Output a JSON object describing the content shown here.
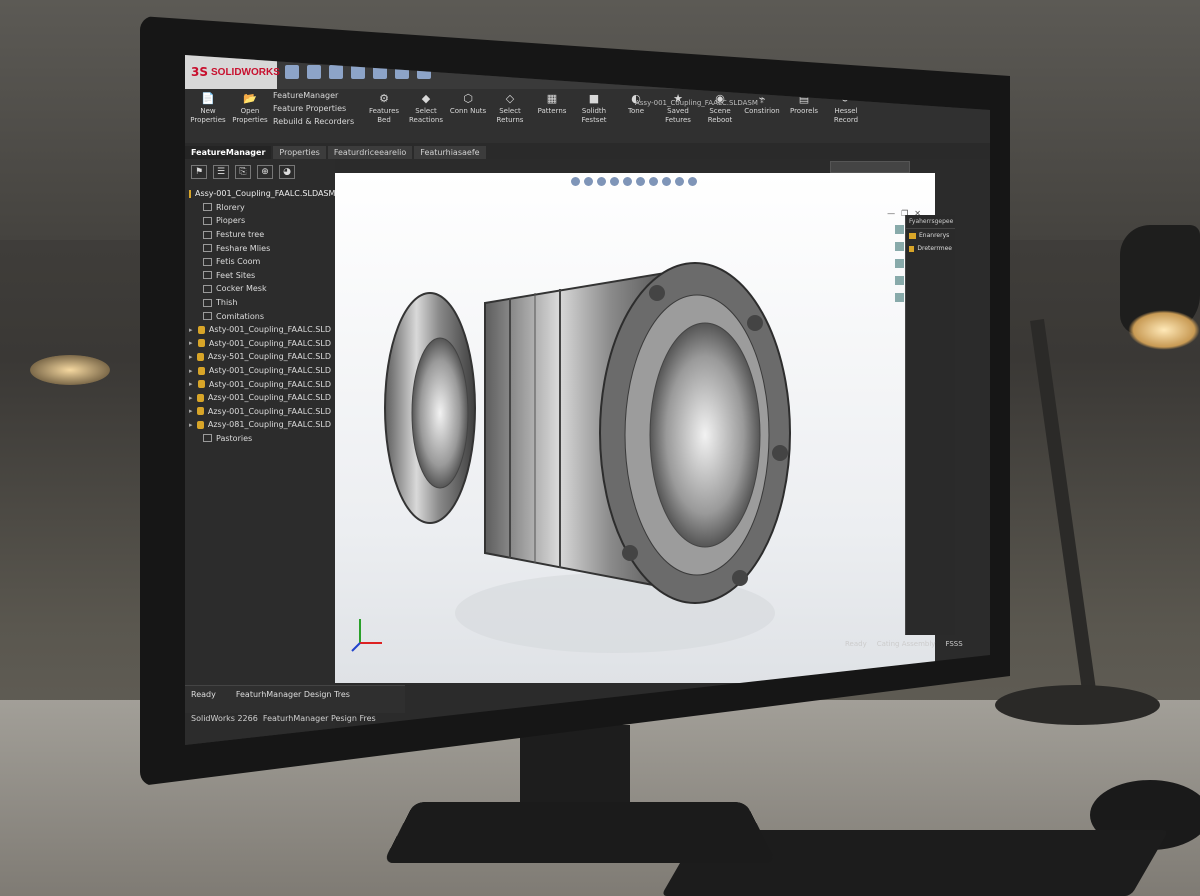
{
  "app": {
    "logo_text": "SOLIDWORKS",
    "document_title": "Assy-001_Coupling_FAALC.SLDASM *"
  },
  "ribbon": {
    "buttons": [
      {
        "label": "New Properties",
        "icon": "new-document-icon"
      },
      {
        "label": "Open Properties",
        "icon": "open-folder-icon"
      }
    ],
    "column": [
      "FeatureManager",
      "Feature Properties",
      "Rebuild & Recorders"
    ],
    "group": [
      {
        "label": "Features Bed",
        "icon": "features-icon"
      },
      {
        "label": "Select Reactions",
        "icon": "select-icon"
      },
      {
        "label": "Conn Nuts",
        "icon": "connect-icon"
      },
      {
        "label": "Select Returns",
        "icon": "select-returns-icon"
      },
      {
        "label": "Patterns",
        "icon": "pattern-icon"
      },
      {
        "label": "Solidth Festset",
        "icon": "solid-icon"
      },
      {
        "label": "Tone",
        "icon": "tone-icon"
      },
      {
        "label": "Saved Fetures",
        "icon": "saved-icon"
      },
      {
        "label": "Scene Reboot",
        "icon": "scene-icon"
      },
      {
        "label": "Constirion",
        "icon": "constraint-icon"
      },
      {
        "label": "Proorels",
        "icon": "process-icon"
      },
      {
        "label": "Hessel Record",
        "icon": "record-icon"
      }
    ]
  },
  "tabs": [
    "FeatureManager",
    "Properties",
    "Featurdriceearelio",
    "Featurhiasaefe"
  ],
  "tree": {
    "root": "Assy-001_Coupling_FAALC.SLDASM",
    "items": [
      "Rlorery",
      "Piopers",
      "Festure tree",
      "Feshare Mlies",
      "Fetis Coom",
      "Feet Sites",
      "Cocker Mesk",
      "Thish",
      "Comitations"
    ],
    "parts": [
      "Asty-001_Coupling_FAALC.SLD",
      "Asty-001_Coupling_FAALC.SLD",
      "Azsy-501_Coupling_FAALC.SLD",
      "Asty-001_Coupling_FAALC.SLD",
      "Asty-001_Coupling_FAALC.SLD",
      "Azsy-001_Coupling_FAALC.SLD",
      "Azsy-001_Coupling_FAALC.SLD",
      "Azsy-081_Coupling_FAALC.SLD"
    ],
    "last": "Pastories"
  },
  "status": {
    "left_ready": "Ready",
    "left_tree": "FeaturhManager Design Tres",
    "bottom_app": "SolidWorks 2266",
    "bottom_tree": "FeaturhManager Pesign Fres",
    "right_ready": "Ready",
    "right_assembly": "Cating Assembly",
    "right_unit": "FSSS"
  },
  "taskpane": {
    "title": "Fyaherrsgepee",
    "items": [
      "Enanrerys",
      "Dreterrmee"
    ]
  }
}
